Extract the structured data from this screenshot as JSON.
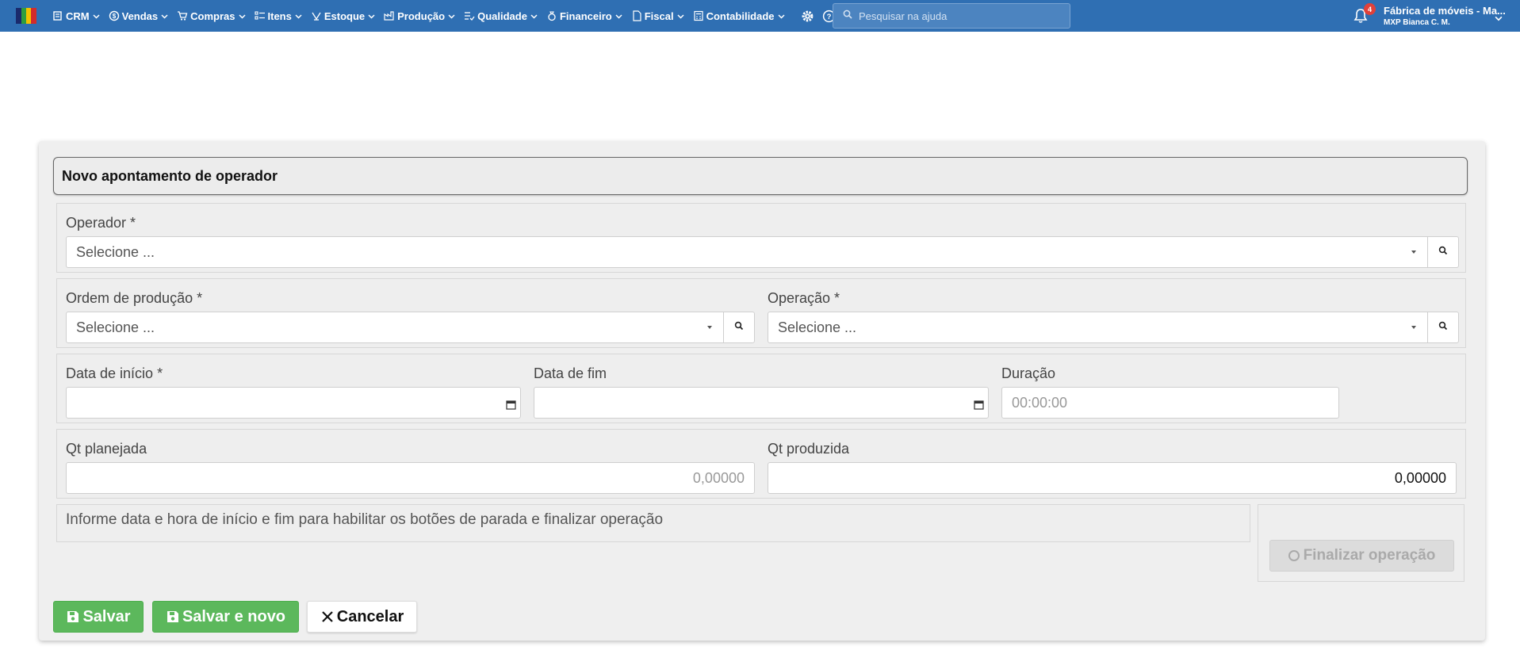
{
  "nav": {
    "items": [
      {
        "label": "CRM",
        "icon": "crm-icon"
      },
      {
        "label": "Vendas",
        "icon": "dollar-icon"
      },
      {
        "label": "Compras",
        "icon": "cart-icon"
      },
      {
        "label": "Itens",
        "icon": "items-icon"
      },
      {
        "label": "Estoque",
        "icon": "stock-icon"
      },
      {
        "label": "Produção",
        "icon": "factory-icon"
      },
      {
        "label": "Qualidade",
        "icon": "list-check-icon"
      },
      {
        "label": "Financeiro",
        "icon": "money-bag-icon"
      },
      {
        "label": "Fiscal",
        "icon": "document-icon"
      },
      {
        "label": "Contabilidade",
        "icon": "calculator-icon"
      }
    ],
    "search_placeholder": "Pesquisar na ajuda",
    "notification_count": "4",
    "company_name": "Fábrica de móveis - Ma...",
    "user_name": "MXP Bianca C. M."
  },
  "form": {
    "title": "Novo apontamento de operador",
    "operador_label": "Operador *",
    "operador_value": "Selecione ...",
    "ordem_label": "Ordem de produção *",
    "ordem_value": "Selecione ...",
    "operacao_label": "Operação *",
    "operacao_value": "Selecione ...",
    "data_inicio_label": "Data de início *",
    "data_inicio_value": "",
    "data_fim_label": "Data de fim",
    "data_fim_value": "",
    "duracao_label": "Duração",
    "duracao_placeholder": "00:00:00",
    "qt_planejada_label": "Qt planejada",
    "qt_planejada_placeholder": "0,00000",
    "qt_produzida_label": "Qt produzida",
    "qt_produzida_value": "0,00000",
    "info_text": "Informe data e hora de início e fim para habilitar os botões de parada e finalizar operação",
    "finalizar_label": "Finalizar operação"
  },
  "actions": {
    "save_label": "Salvar",
    "save_new_label": "Salvar e novo",
    "cancel_label": "Cancelar"
  },
  "colors": {
    "topbar": "#2f6fb3",
    "success": "#5cb85c",
    "badge": "#e0413a"
  }
}
